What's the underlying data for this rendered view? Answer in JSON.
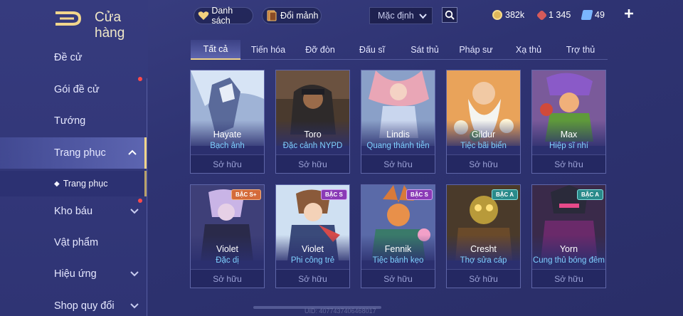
{
  "header": {
    "title": "Cửa hàng"
  },
  "sidebar": {
    "items": [
      {
        "label": "Đề cử"
      },
      {
        "label": "Gói đề cử"
      },
      {
        "label": "Tướng"
      },
      {
        "label": "Trang phục"
      },
      {
        "label": "Kho báu"
      },
      {
        "label": "Vật phẩm"
      },
      {
        "label": "Hiệu ứng"
      },
      {
        "label": "Shop quy đổi"
      }
    ],
    "sub_item": {
      "label": "Trang phục"
    }
  },
  "topbar": {
    "list_label": "Danh sách",
    "exchange_label": "Đổi mảnh",
    "sort_selected": "Mặc định",
    "currencies": [
      {
        "value": "382k",
        "icon": "gold-coin-icon",
        "color": "#e0b85a"
      },
      {
        "value": "1 345",
        "icon": "ruby-icon",
        "color": "#d65a5a"
      },
      {
        "value": "49",
        "icon": "voucher-icon",
        "color": "#7ab6ff"
      }
    ]
  },
  "tabs": [
    {
      "label": "Tất cả"
    },
    {
      "label": "Tiến hóa"
    },
    {
      "label": "Đỡ đòn"
    },
    {
      "label": "Đấu sĩ"
    },
    {
      "label": "Sát thủ"
    },
    {
      "label": "Pháp sư"
    },
    {
      "label": "Xạ thủ"
    },
    {
      "label": "Trợ thủ"
    }
  ],
  "cards": [
    {
      "hero": "Hayate",
      "skin": "Bạch ảnh",
      "status": "Sở hữu"
    },
    {
      "hero": "Toro",
      "skin": "Đặc cảnh NYPD",
      "status": "Sở hữu"
    },
    {
      "hero": "Lindis",
      "skin": "Quang thánh tiễn",
      "status": "Sở hữu"
    },
    {
      "hero": "Gildur",
      "skin": "Tiệc bãi biển",
      "status": "Sở hữu"
    },
    {
      "hero": "Max",
      "skin": "Hiệp sĩ nhí",
      "status": "Sở hữu"
    },
    {
      "hero": "Violet",
      "skin": "Đặc dị",
      "status": "Sở hữu",
      "badge": "BẬC S+"
    },
    {
      "hero": "Violet",
      "skin": "Phi công trẻ",
      "status": "Sở hữu",
      "badge": "BẬC S"
    },
    {
      "hero": "Fennik",
      "skin": "Tiệc bánh kẹo",
      "status": "Sở hữu",
      "badge": "BẬC S"
    },
    {
      "hero": "Cresht",
      "skin": "Thợ sửa cáp",
      "status": "Sở hữu",
      "badge": "BẬC A"
    },
    {
      "hero": "Yorn",
      "skin": "Cung thủ bóng đêm",
      "status": "Sở hữu",
      "badge": "BẬC A"
    }
  ],
  "footer": {
    "uid": "UID: 4077437406468017"
  },
  "colors": {
    "accent": "#f0d48a",
    "skin_text": "#7fd0ff",
    "notify": "#ff4a4a"
  }
}
